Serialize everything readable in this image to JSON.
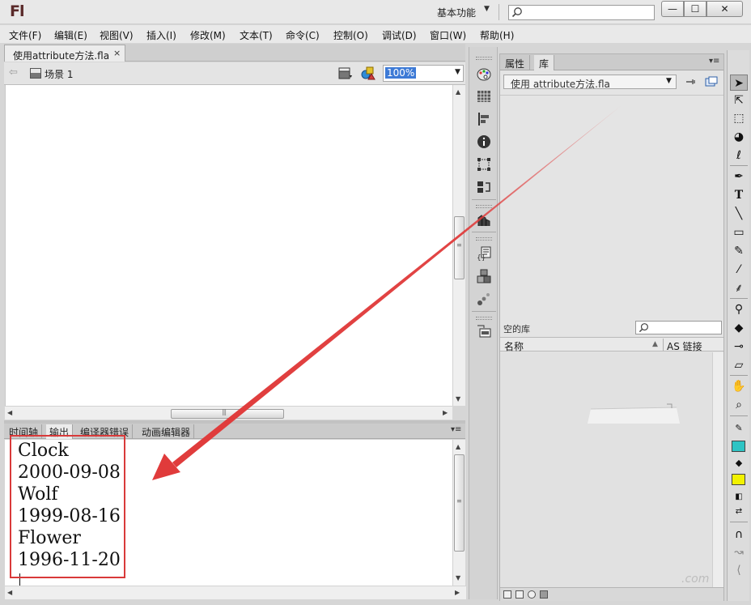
{
  "window": {
    "app_logo": "Fl",
    "workspace_label": "基本功能",
    "min_glyph": "—",
    "max_glyph": "☐",
    "close_glyph": "✕"
  },
  "menubar": {
    "items": [
      "文件(F)",
      "编辑(E)",
      "视图(V)",
      "插入(I)",
      "修改(M)",
      "文本(T)",
      "命令(C)",
      "控制(O)",
      "调试(D)",
      "窗口(W)",
      "帮助(H)"
    ]
  },
  "document": {
    "tab_label": "使用attribute方法.fla",
    "tab_close": "×",
    "scene_label": "场景 1",
    "zoom": "100%"
  },
  "output_panel": {
    "tabs": [
      "时间轴",
      "输出",
      "编译器错误",
      "动画编辑器"
    ],
    "active_tab": "输出",
    "lines": [
      "Clock",
      "2000-09-08",
      "Wolf",
      "1999-08-16",
      "Flower",
      "1996-11-20"
    ]
  },
  "library_panel": {
    "tabs": [
      "属性",
      "库"
    ],
    "active_tab": "库",
    "file_select": "使用 attribute方法.fla",
    "status": "空的库",
    "column_name": "名称",
    "column_link": "AS 链接",
    "watermark": ".com"
  },
  "colors": {
    "annotation_red": "#e03b3b",
    "highlight_box": "#d93a3a",
    "stroke_color_swatch": "#2ec4c4",
    "fill_color_swatch": "#f2f200",
    "zoom_highlight": "#3d7ad6"
  },
  "right_toolbar": {
    "tools": [
      "selection-tool",
      "subselection-tool",
      "free-transform-tool",
      "3d-rotation-tool",
      "lasso-tool",
      "pen-tool",
      "text-tool",
      "line-tool",
      "rectangle-tool",
      "pencil-tool",
      "brush-tool",
      "deco-tool",
      "bone-tool",
      "paint-bucket-tool",
      "eyedropper-tool",
      "eraser-tool",
      "hand-tool",
      "zoom-tool",
      "stroke-color",
      "fill-color",
      "black-white",
      "swap-colors",
      "snap-to-objects"
    ]
  }
}
